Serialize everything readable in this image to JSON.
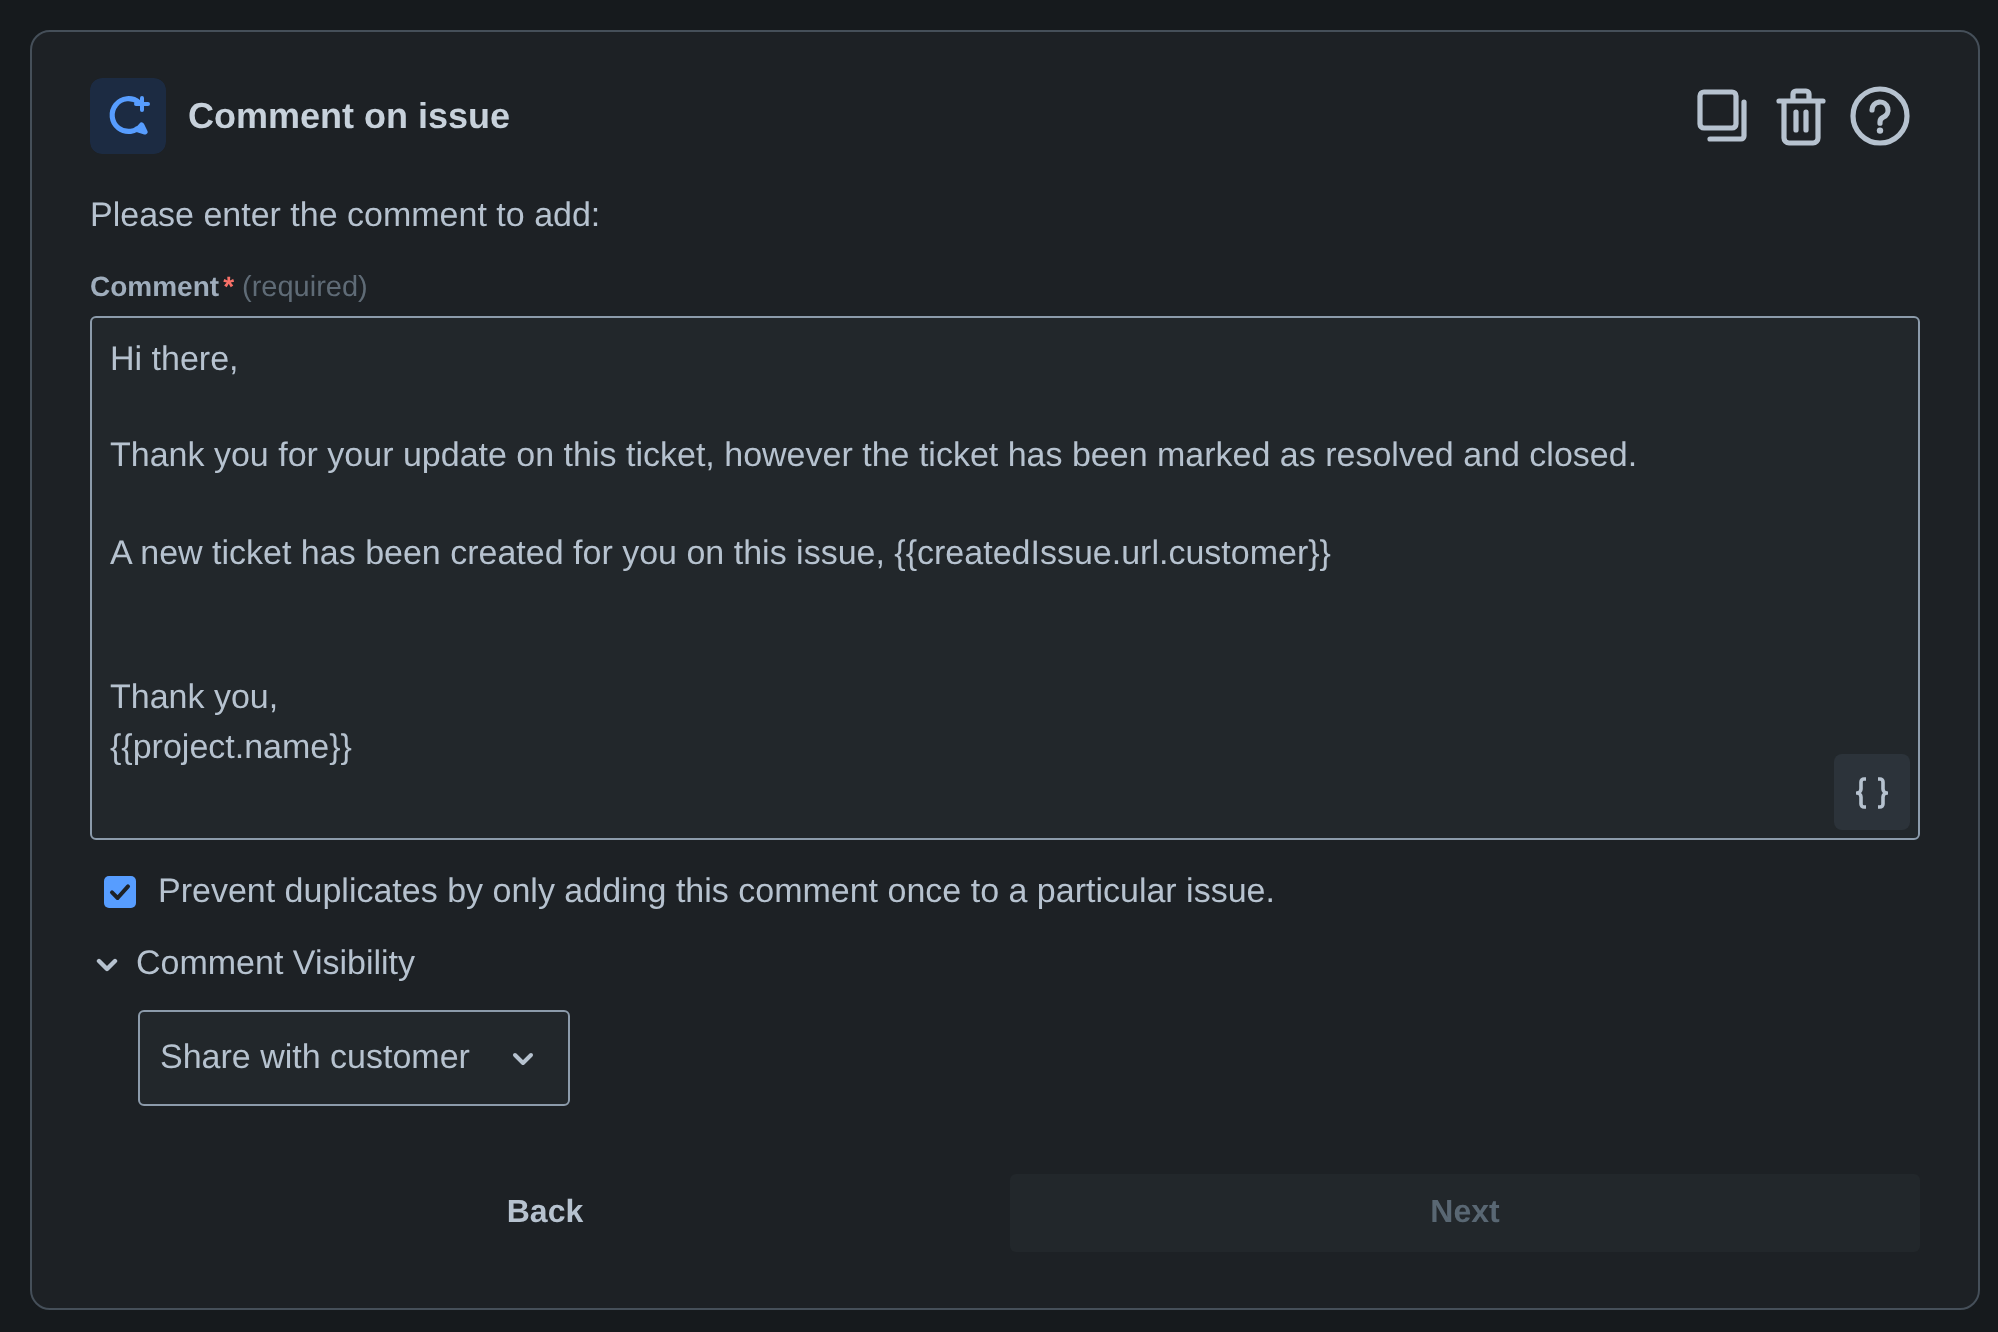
{
  "header": {
    "title": "Comment on issue"
  },
  "intro": "Please enter the comment to add:",
  "comment_field": {
    "label": "Comment",
    "required_mark": "*",
    "hint": "(required)",
    "value": "Hi there,\n\nThank you for your update on this ticket, however the ticket has been marked as resolved and closed.\n\nA new ticket has been created for you on this issue, {{createdIssue.url.customer}}\n\n\nThank you,\n{{project.name}}"
  },
  "prevent_duplicates": {
    "label": "Prevent duplicates by only adding this comment once to a particular issue.",
    "checked": true
  },
  "visibility": {
    "label": "Comment Visibility",
    "expanded": true,
    "dropdown": {
      "value": "Share with customer"
    }
  },
  "buttons": [
    {
      "label": "Back",
      "disabled": false
    },
    {
      "label": "Next",
      "disabled": true
    }
  ]
}
